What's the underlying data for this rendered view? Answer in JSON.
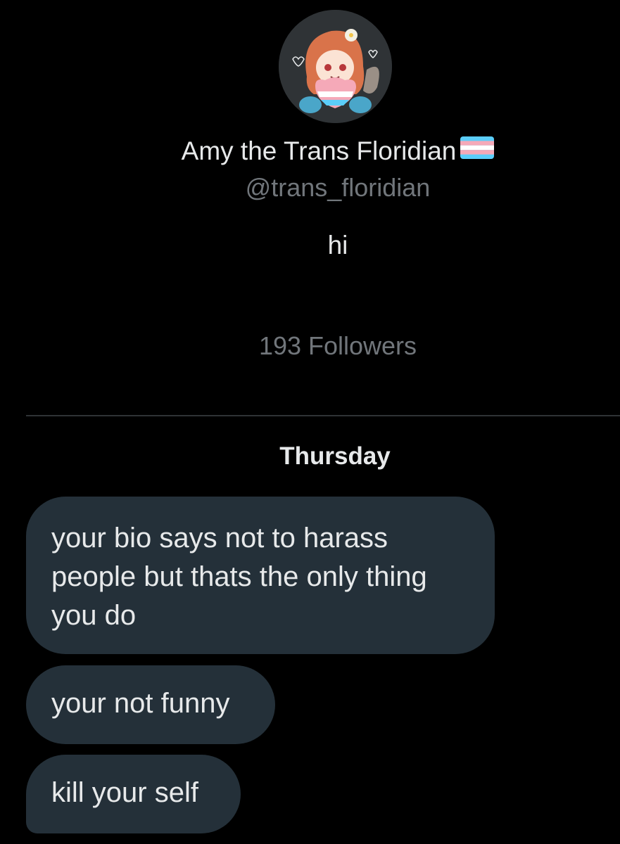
{
  "profile": {
    "display_name": "Amy the Trans Floridian",
    "handle": "@trans_floridian",
    "bio": "hi",
    "followers": "193 Followers",
    "avatar_icon": "avatar-illustration",
    "flag_icon": "trans-flag-icon"
  },
  "conversation": {
    "day_label": "Thursday",
    "messages": [
      {
        "text": "your bio says not to harass people but thats the only thing you do"
      },
      {
        "text": "your not funny"
      },
      {
        "text": "kill your self"
      }
    ]
  },
  "colors": {
    "background": "#000000",
    "primary_text": "#e7e9ea",
    "secondary_text": "#71767b",
    "bubble": "#243039",
    "divider": "#2f3336",
    "flag_blue": "#5bcefa",
    "flag_pink": "#f5a9b8",
    "flag_white": "#ffffff"
  }
}
